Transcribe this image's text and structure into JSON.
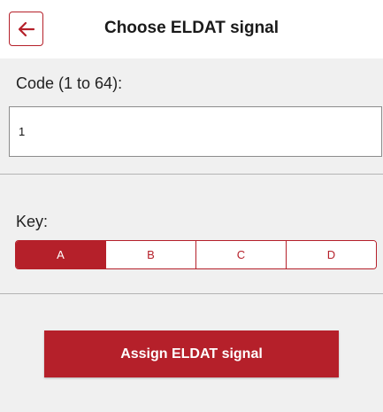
{
  "header": {
    "back_icon": "arrow-left-icon",
    "title": "Choose ELDAT signal"
  },
  "code": {
    "label": "Code (1 to 64):",
    "value": "1"
  },
  "key": {
    "label": "Key:",
    "options": [
      "A",
      "B",
      "C",
      "D"
    ],
    "selected": "A"
  },
  "assign_button_label": "Assign ELDAT signal",
  "colors": {
    "accent": "#b5202a",
    "background": "#f0f0f0",
    "header_background": "#ffffff"
  }
}
